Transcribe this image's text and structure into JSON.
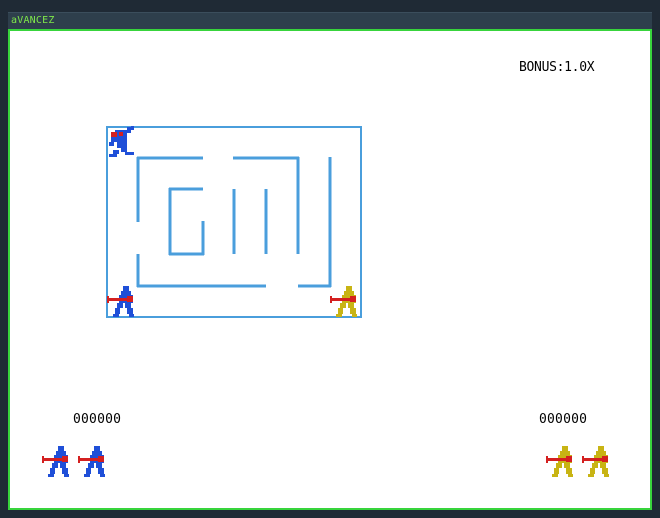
{
  "window": {
    "title": "aVANCEZ"
  },
  "hud": {
    "bonus": "BONUS:1.0X",
    "player1_score": "000000",
    "player2_score": "000000"
  },
  "colors": {
    "frame_border": "#38d43c",
    "maze_wall": "#4a9edc",
    "player_blue": "#1f4fd8",
    "player_yellow": "#c8b414",
    "weapon_red": "#d42020"
  },
  "sprites": {
    "enemy": "crouching-creature-icon",
    "player1": "blue-gunner-icon",
    "player2": "yellow-gunner-icon"
  },
  "lives": {
    "player1": 2,
    "player2": 2
  }
}
